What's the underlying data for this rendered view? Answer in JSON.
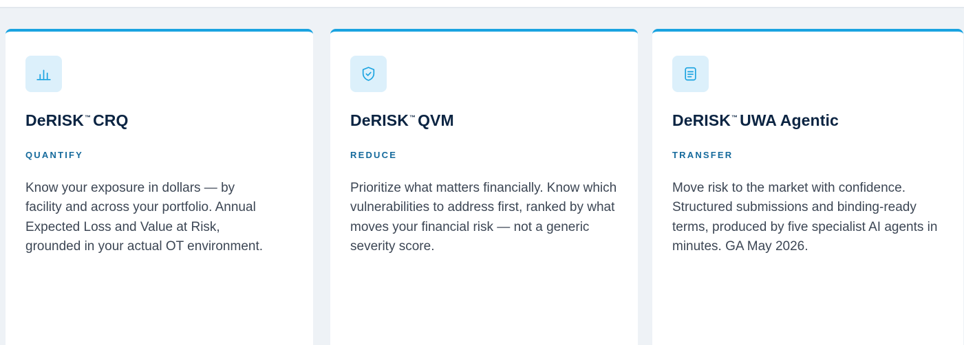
{
  "cards": [
    {
      "icon": "bar-chart-icon",
      "product": "DeRISK",
      "tm": "™",
      "suffix": "CRQ",
      "category": "QUANTIFY",
      "description": "Know your exposure in dollars — by facility and across your portfolio. Annual Expected Loss and Value at Risk, grounded in your actual OT environment."
    },
    {
      "icon": "shield-check-icon",
      "product": "DeRISK",
      "tm": "™",
      "suffix": "QVM",
      "category": "REDUCE",
      "description": "Prioritize what matters financially. Know which vulnerabilities to address first, ranked by what moves your financial risk — not a generic severity score."
    },
    {
      "icon": "document-icon",
      "product": "DeRISK",
      "tm": "™",
      "suffix": "UWA Agentic",
      "category": "TRANSFER",
      "description": "Move risk to the market with confidence. Structured submissions and binding-ready terms, produced by five specialist AI agents in minutes. GA May 2026."
    }
  ],
  "colors": {
    "accent": "#1aa3e0",
    "title": "#0b2442",
    "category": "#156a9c",
    "body": "#3c4654",
    "icon_bg": "#dcf0fb"
  }
}
